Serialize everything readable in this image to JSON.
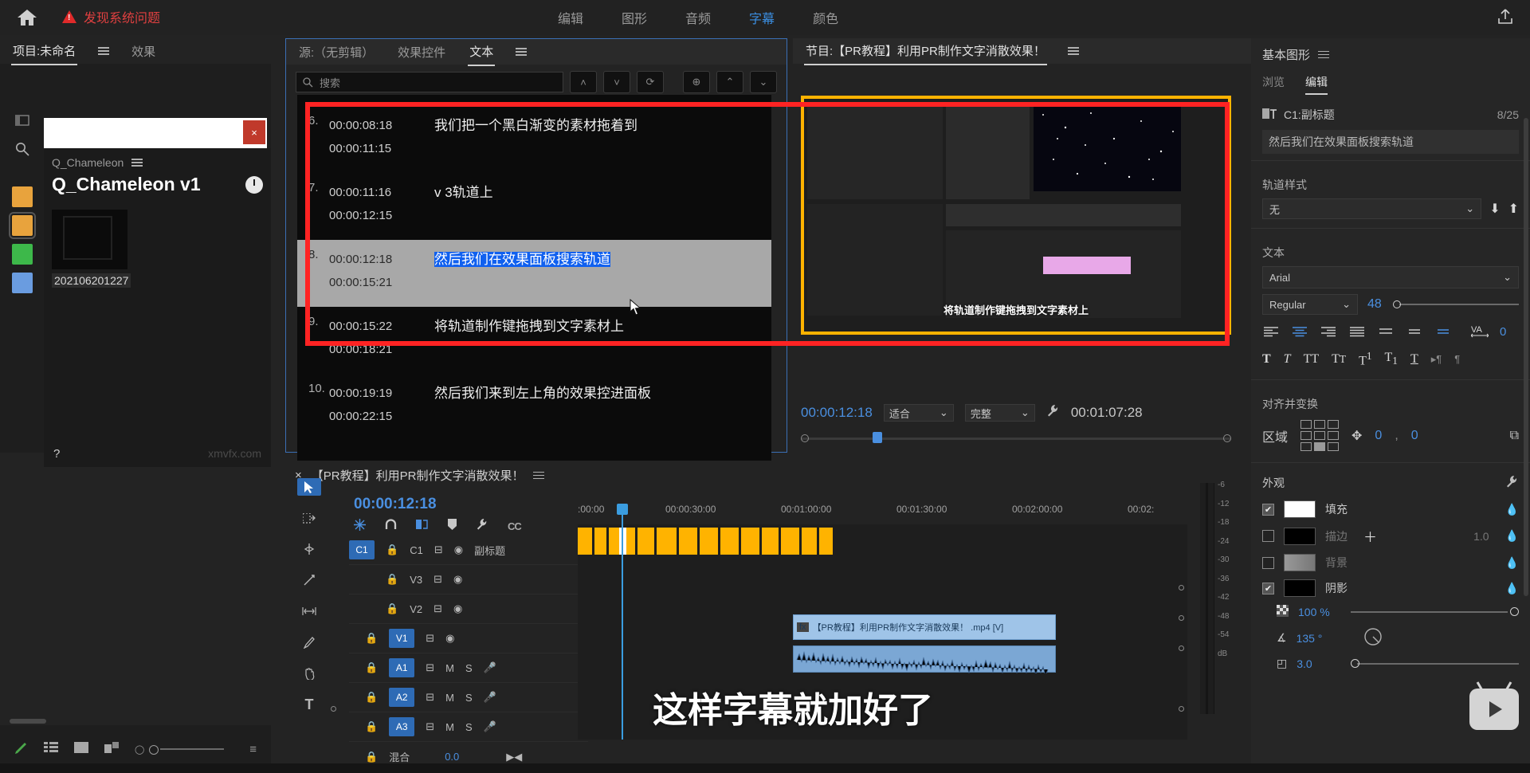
{
  "topbar": {
    "home_icon": "home-icon",
    "warning_text": "发现系统问题",
    "menu": [
      {
        "label": "编辑",
        "active": false
      },
      {
        "label": "图形",
        "active": false
      },
      {
        "label": "音频",
        "active": false
      },
      {
        "label": "字幕",
        "active": true
      },
      {
        "label": "颜色",
        "active": false
      }
    ],
    "share_icon": "share-icon"
  },
  "project_panel": {
    "tabs": [
      {
        "label": "项目:未命名",
        "active": true
      },
      {
        "label": "效果",
        "active": false
      }
    ],
    "menu_icon": "hamburger-icon",
    "dialog_close": "×",
    "breadcrumb": "Q_Chameleon",
    "preset_title": "Q_Chameleon v1",
    "thumb_caption": "202106201227",
    "watermark": "xmvfx.com",
    "help": "?",
    "swatches": [
      "#e8a33d",
      "#e8a33d",
      "#3db84a",
      "#6a9ce0"
    ]
  },
  "source_panel": {
    "tabs": [
      {
        "label": "源:（无剪辑）",
        "active": false
      },
      {
        "label": "效果控件",
        "active": false
      },
      {
        "label": "文本",
        "active": true
      }
    ],
    "menu_icon": "hamburger-icon",
    "search_placeholder": "搜索",
    "buttons": [
      "prev-caption-icon",
      "next-caption-icon",
      "sync-icon",
      "add-caption-icon",
      "merge-up-icon",
      "split-down-icon"
    ],
    "captions": [
      {
        "num": "6.",
        "start": "00:00:08:18",
        "end": "00:00:11:15",
        "text": "我们把一个黑白渐变的素材拖着到",
        "selected": false,
        "highlight": false
      },
      {
        "num": "7.",
        "start": "00:00:11:16",
        "end": "00:00:12:15",
        "text": "v 3轨道上",
        "selected": false,
        "highlight": false
      },
      {
        "num": "8.",
        "start": "00:00:12:18",
        "end": "00:00:15:21",
        "text": "然后我们在效果面板搜索轨道",
        "selected": true,
        "highlight": true
      },
      {
        "num": "9.",
        "start": "00:00:15:22",
        "end": "00:00:18:21",
        "text": "将轨道制作键拖拽到文字素材上",
        "selected": false,
        "highlight": false
      },
      {
        "num": "10.",
        "start": "00:00:19:19",
        "end": "00:00:22:15",
        "text": "然后我们来到左上角的效果控进面板",
        "selected": false,
        "highlight": false
      }
    ]
  },
  "program_panel": {
    "title": "节目:【PR教程】利用PR制作文字消散效果！",
    "menu_icon": "hamburger-icon",
    "preview_caption": "将轨道制作键拖拽到文字素材上",
    "current_time": "00:00:12:18",
    "fit_label": "适合",
    "quality_label": "完整",
    "wrench_icon": "wrench-icon",
    "duration": "00:01:07:28",
    "controls": [
      "mark-in-icon",
      "go-to-in-icon",
      "step-back-icon",
      "play-icon",
      "step-forward-icon",
      "go-to-out-icon",
      "lift-icon",
      "more-icon",
      "add-icon"
    ]
  },
  "timeline_panel": {
    "close_icon": "×",
    "sequence_name": "【PR教程】利用PR制作文字消散效果！",
    "menu_icon": "hamburger-icon",
    "playhead_time": "00:00:12:18",
    "tool_icons": [
      "snap-toggle-icon",
      "magnet-icon",
      "linked-selection-icon",
      "marker-icon",
      "settings-wrench-icon",
      "closed-caption-icon"
    ],
    "ruler_labels": [
      ":00:00",
      "00:00:30:00",
      "00:01:00:00",
      "00:01:30:00",
      "00:02:00:00",
      "00:02:"
    ],
    "tracks": [
      {
        "badge": "C1",
        "name": "C1",
        "label": "副标题",
        "has_badge": true,
        "type": "caption"
      },
      {
        "badge": "",
        "name": "V3",
        "label": "",
        "has_badge": false,
        "type": "video"
      },
      {
        "badge": "",
        "name": "V2",
        "label": "",
        "has_badge": false,
        "type": "video"
      },
      {
        "badge": "V1",
        "name": "V1",
        "label": "",
        "has_badge": true,
        "type": "video"
      },
      {
        "badge": "A1",
        "name": "A1",
        "label": "",
        "has_badge": true,
        "type": "audio"
      },
      {
        "badge": "A2",
        "name": "A2",
        "label": "",
        "has_badge": true,
        "type": "audio"
      },
      {
        "badge": "A3",
        "name": "A3",
        "label": "",
        "has_badge": true,
        "type": "audio"
      }
    ],
    "audio_mix_label": "混合",
    "audio_mix_value": "0.0",
    "mute_label": "M",
    "solo_label": "S",
    "clip_name": "【PR教程】利用PR制作文字消散效果！ .mp4 [V]",
    "burned_caption": "这样字幕就加好了",
    "tools": [
      "selection-tool-icon",
      "track-select-forward-icon",
      "ripple-edit-icon",
      "rolling-edit-icon",
      "slip-tool-icon",
      "pen-tool-icon",
      "hand-tool-icon",
      "type-tool-icon"
    ]
  },
  "audio_meter": {
    "scale": [
      "-6",
      "-12",
      "-18",
      "-24",
      "-30",
      "-36",
      "-42",
      "-48",
      "-54",
      "dB"
    ]
  },
  "right_panel": {
    "title": "基本图形",
    "menu_icon": "hamburger-icon",
    "tabs": [
      {
        "label": "浏览",
        "active": false
      },
      {
        "label": "编辑",
        "active": true
      }
    ],
    "layer_name": "C1:副标题",
    "layer_count": "8/25",
    "layer_icon": "text-layer-icon",
    "text_value": "然后我们在效果面板搜索轨道",
    "track_style_label": "轨道样式",
    "track_style_value": "无",
    "text_section": "文本",
    "font_family": "Arial",
    "font_style": "Regular",
    "font_size": "48",
    "tracking_label": "VA",
    "tracking_value": "0",
    "align_icons": [
      "align-left-icon",
      "align-center-icon",
      "align-right-icon",
      "justify-icon",
      "vertical-top-icon",
      "vertical-center-icon",
      "vertical-bottom-icon"
    ],
    "typo_icons": [
      "bold-icon",
      "italic-icon",
      "all-caps-icon",
      "small-caps-icon",
      "superscript-icon",
      "subscript-icon",
      "underline-icon",
      "ltr-icon",
      "rtl-icon"
    ],
    "align_transform_label": "对齐并变换",
    "region_label": "区域",
    "position_x": "0",
    "position_y": "0",
    "appearance_label": "外观",
    "appearance_wrench": "wrench-icon",
    "appearance": [
      {
        "label": "填充",
        "checked": true,
        "color": "#ffffff",
        "extra": ""
      },
      {
        "label": "描边",
        "checked": false,
        "color": "#000000",
        "extra": "1.0"
      },
      {
        "label": "背景",
        "checked": false,
        "color": "#888888",
        "extra": ""
      },
      {
        "label": "阴影",
        "checked": true,
        "color": "#000000",
        "extra": ""
      }
    ],
    "shadow_opacity": "100 %",
    "shadow_angle": "135 °",
    "shadow_distance": "3.0"
  },
  "colors": {
    "accent_blue": "#4a8fe0",
    "highlight_red": "#ff2323",
    "caption_orange": "#ffb300",
    "warning_red": "#e04040"
  }
}
